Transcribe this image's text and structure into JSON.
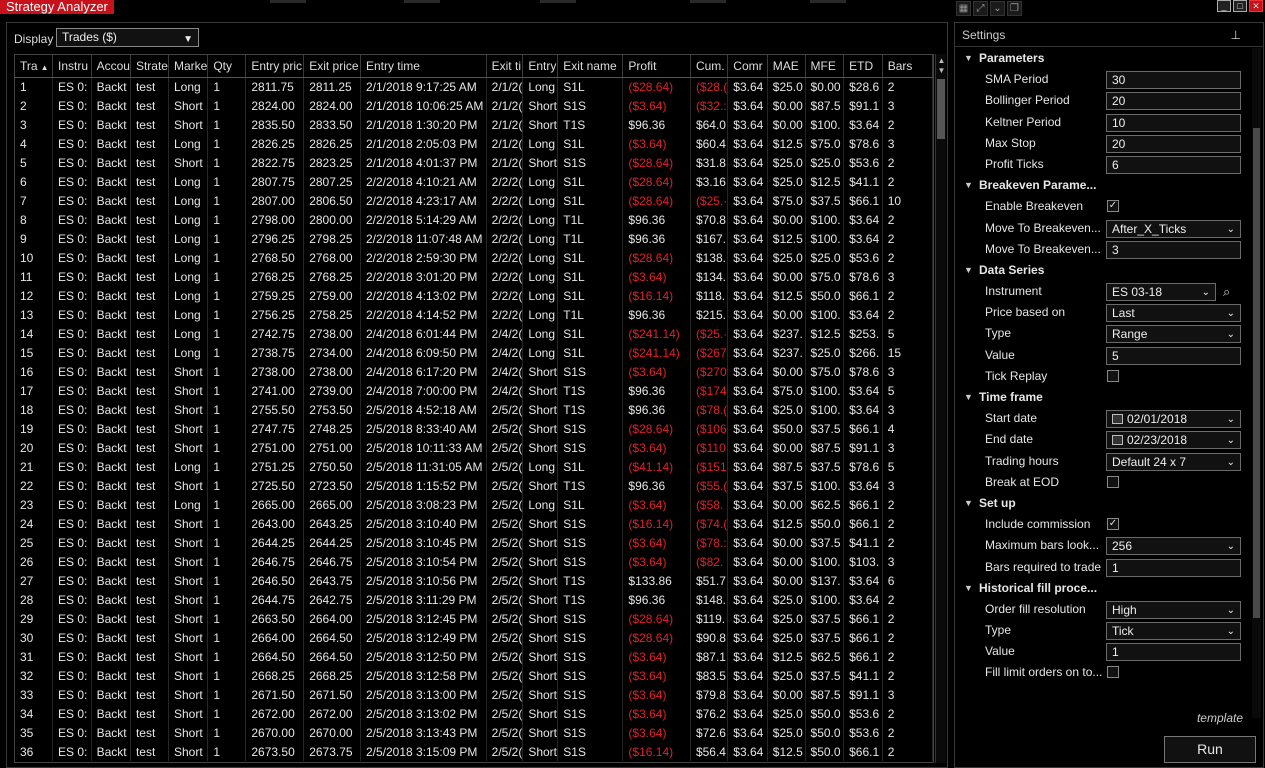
{
  "window": {
    "title": "Strategy Analyzer",
    "window_buttons": [
      "_",
      "□",
      "✕"
    ]
  },
  "display": {
    "label": "Display",
    "value": "Trades ($)"
  },
  "grid": {
    "columns": [
      "Tra",
      "Instru",
      "Accou",
      "Strate",
      "Marke",
      "Qty",
      "Entry pric",
      "Exit price",
      "Entry time",
      "Exit ti",
      "Entry",
      "Exit name",
      "Profit",
      "Cum.",
      "Comr",
      "MAE",
      "MFE",
      "ETD",
      "Bars"
    ],
    "sort_indicator": "▲",
    "rows": [
      [
        "1",
        "ES 0:",
        "Backt",
        "test",
        "Long",
        "1",
        "2811.75",
        "2811.25",
        "2/1/2018 9:17:25 AM",
        "2/1/2(",
        "Long",
        "S1L",
        "($28.64)",
        "($28.(",
        "$3.64",
        "$25.0",
        "$0.00",
        "$28.6",
        "2"
      ],
      [
        "2",
        "ES 0:",
        "Backt",
        "test",
        "Short",
        "1",
        "2824.00",
        "2824.00",
        "2/1/2018 10:06:25 AM",
        "2/1/2(",
        "Short",
        "S1S",
        "($3.64)",
        "($32.:",
        "$3.64",
        "$0.00",
        "$87.5",
        "$91.1",
        "3"
      ],
      [
        "3",
        "ES 0:",
        "Backt",
        "test",
        "Short",
        "1",
        "2835.50",
        "2833.50",
        "2/1/2018 1:30:20 PM",
        "2/1/2(",
        "Short",
        "T1S",
        "$96.36",
        "$64.0",
        "$3.64",
        "$0.00",
        "$100.",
        "$3.64",
        "2"
      ],
      [
        "4",
        "ES 0:",
        "Backt",
        "test",
        "Long",
        "1",
        "2826.25",
        "2826.25",
        "2/1/2018 2:05:03 PM",
        "2/1/2(",
        "Long",
        "S1L",
        "($3.64)",
        "$60.4",
        "$3.64",
        "$12.5",
        "$75.0",
        "$78.6",
        "3"
      ],
      [
        "5",
        "ES 0:",
        "Backt",
        "test",
        "Short",
        "1",
        "2822.75",
        "2823.25",
        "2/1/2018 4:01:37 PM",
        "2/1/2(",
        "Short",
        "S1S",
        "($28.64)",
        "$31.8",
        "$3.64",
        "$25.0",
        "$25.0",
        "$53.6",
        "2"
      ],
      [
        "6",
        "ES 0:",
        "Backt",
        "test",
        "Long",
        "1",
        "2807.75",
        "2807.25",
        "2/2/2018 4:10:21 AM",
        "2/2/2(",
        "Long",
        "S1L",
        "($28.64)",
        "$3.16",
        "$3.64",
        "$25.0",
        "$12.5",
        "$41.1",
        "2"
      ],
      [
        "7",
        "ES 0:",
        "Backt",
        "test",
        "Long",
        "1",
        "2807.00",
        "2806.50",
        "2/2/2018 4:23:17 AM",
        "2/2/2(",
        "Long",
        "S1L",
        "($28.64)",
        "($25.·",
        "$3.64",
        "$75.0",
        "$37.5",
        "$66.1",
        "10"
      ],
      [
        "8",
        "ES 0:",
        "Backt",
        "test",
        "Long",
        "1",
        "2798.00",
        "2800.00",
        "2/2/2018 5:14:29 AM",
        "2/2/2(",
        "Long",
        "T1L",
        "$96.36",
        "$70.8",
        "$3.64",
        "$0.00",
        "$100.",
        "$3.64",
        "2"
      ],
      [
        "9",
        "ES 0:",
        "Backt",
        "test",
        "Long",
        "1",
        "2796.25",
        "2798.25",
        "2/2/2018 11:07:48 AM",
        "2/2/2(",
        "Long",
        "T1L",
        "$96.36",
        "$167.",
        "$3.64",
        "$12.5",
        "$100.",
        "$3.64",
        "2"
      ],
      [
        "10",
        "ES 0:",
        "Backt",
        "test",
        "Long",
        "1",
        "2768.50",
        "2768.00",
        "2/2/2018 2:59:30 PM",
        "2/2/2(",
        "Long",
        "S1L",
        "($28.64)",
        "$138.",
        "$3.64",
        "$25.0",
        "$25.0",
        "$53.6",
        "2"
      ],
      [
        "11",
        "ES 0:",
        "Backt",
        "test",
        "Long",
        "1",
        "2768.25",
        "2768.25",
        "2/2/2018 3:01:20 PM",
        "2/2/2(",
        "Long",
        "S1L",
        "($3.64)",
        "$134.",
        "$3.64",
        "$0.00",
        "$75.0",
        "$78.6",
        "3"
      ],
      [
        "12",
        "ES 0:",
        "Backt",
        "test",
        "Long",
        "1",
        "2759.25",
        "2759.00",
        "2/2/2018 4:13:02 PM",
        "2/2/2(",
        "Long",
        "S1L",
        "($16.14)",
        "$118.",
        "$3.64",
        "$12.5",
        "$50.0",
        "$66.1",
        "2"
      ],
      [
        "13",
        "ES 0:",
        "Backt",
        "test",
        "Long",
        "1",
        "2756.25",
        "2758.25",
        "2/2/2018 4:14:52 PM",
        "2/2/2(",
        "Long",
        "T1L",
        "$96.36",
        "$215.",
        "$3.64",
        "$0.00",
        "$100.",
        "$3.64",
        "2"
      ],
      [
        "14",
        "ES 0:",
        "Backt",
        "test",
        "Long",
        "1",
        "2742.75",
        "2738.00",
        "2/4/2018 6:01:44 PM",
        "2/4/2(",
        "Long",
        "S1L",
        "($241.14)",
        "($25.·",
        "$3.64",
        "$237.",
        "$12.5",
        "$253.",
        "5"
      ],
      [
        "15",
        "ES 0:",
        "Backt",
        "test",
        "Long",
        "1",
        "2738.75",
        "2734.00",
        "2/4/2018 6:09:50 PM",
        "2/4/2(",
        "Long",
        "S1L",
        "($241.14)",
        "($267",
        "$3.64",
        "$237.",
        "$25.0",
        "$266.",
        "15"
      ],
      [
        "16",
        "ES 0:",
        "Backt",
        "test",
        "Short",
        "1",
        "2738.00",
        "2738.00",
        "2/4/2018 6:17:20 PM",
        "2/4/2(",
        "Short",
        "S1S",
        "($3.64)",
        "($270",
        "$3.64",
        "$0.00",
        "$75.0",
        "$78.6",
        "3"
      ],
      [
        "17",
        "ES 0:",
        "Backt",
        "test",
        "Short",
        "1",
        "2741.00",
        "2739.00",
        "2/4/2018 7:00:00 PM",
        "2/4/2(",
        "Short",
        "T1S",
        "$96.36",
        "($174",
        "$3.64",
        "$75.0",
        "$100.",
        "$3.64",
        "5"
      ],
      [
        "18",
        "ES 0:",
        "Backt",
        "test",
        "Short",
        "1",
        "2755.50",
        "2753.50",
        "2/5/2018 4:52:18 AM",
        "2/5/2(",
        "Short",
        "T1S",
        "$96.36",
        "($78.(",
        "$3.64",
        "$25.0",
        "$100.",
        "$3.64",
        "3"
      ],
      [
        "19",
        "ES 0:",
        "Backt",
        "test",
        "Short",
        "1",
        "2747.75",
        "2748.25",
        "2/5/2018 8:33:40 AM",
        "2/5/2(",
        "Short",
        "S1S",
        "($28.64)",
        "($106",
        "$3.64",
        "$50.0",
        "$37.5",
        "$66.1",
        "4"
      ],
      [
        "20",
        "ES 0:",
        "Backt",
        "test",
        "Short",
        "1",
        "2751.00",
        "2751.00",
        "2/5/2018 10:11:33 AM",
        "2/5/2(",
        "Short",
        "S1S",
        "($3.64)",
        "($110",
        "$3.64",
        "$0.00",
        "$87.5",
        "$91.1",
        "3"
      ],
      [
        "21",
        "ES 0:",
        "Backt",
        "test",
        "Long",
        "1",
        "2751.25",
        "2750.50",
        "2/5/2018 11:31:05 AM",
        "2/5/2(",
        "Long",
        "S1L",
        "($41.14)",
        "($151",
        "$3.64",
        "$87.5",
        "$37.5",
        "$78.6",
        "5"
      ],
      [
        "22",
        "ES 0:",
        "Backt",
        "test",
        "Short",
        "1",
        "2725.50",
        "2723.50",
        "2/5/2018 1:15:52 PM",
        "2/5/2(",
        "Short",
        "T1S",
        "$96.36",
        "($55.(",
        "$3.64",
        "$37.5",
        "$100.",
        "$3.64",
        "3"
      ],
      [
        "23",
        "ES 0:",
        "Backt",
        "test",
        "Long",
        "1",
        "2665.00",
        "2665.00",
        "2/5/2018 3:08:23 PM",
        "2/5/2(",
        "Long",
        "S1L",
        "($3.64)",
        "($58.",
        "$3.64",
        "$0.00",
        "$62.5",
        "$66.1",
        "2"
      ],
      [
        "24",
        "ES 0:",
        "Backt",
        "test",
        "Short",
        "1",
        "2643.00",
        "2643.25",
        "2/5/2018 3:10:40 PM",
        "2/5/2(",
        "Short",
        "S1S",
        "($16.14)",
        "($74.(",
        "$3.64",
        "$12.5",
        "$50.0",
        "$66.1",
        "2"
      ],
      [
        "25",
        "ES 0:",
        "Backt",
        "test",
        "Short",
        "1",
        "2644.25",
        "2644.25",
        "2/5/2018 3:10:45 PM",
        "2/5/2(",
        "Short",
        "S1S",
        "($3.64)",
        "($78.:",
        "$3.64",
        "$0.00",
        "$37.5",
        "$41.1",
        "2"
      ],
      [
        "26",
        "ES 0:",
        "Backt",
        "test",
        "Short",
        "1",
        "2646.75",
        "2646.75",
        "2/5/2018 3:10:54 PM",
        "2/5/2(",
        "Short",
        "S1S",
        "($3.64)",
        "($82.",
        "$3.64",
        "$0.00",
        "$100.",
        "$103.",
        "3"
      ],
      [
        "27",
        "ES 0:",
        "Backt",
        "test",
        "Short",
        "1",
        "2646.50",
        "2643.75",
        "2/5/2018 3:10:56 PM",
        "2/5/2(",
        "Short",
        "T1S",
        "$133.86",
        "$51.7",
        "$3.64",
        "$0.00",
        "$137.",
        "$3.64",
        "6"
      ],
      [
        "28",
        "ES 0:",
        "Backt",
        "test",
        "Short",
        "1",
        "2644.75",
        "2642.75",
        "2/5/2018 3:11:29 PM",
        "2/5/2(",
        "Short",
        "T1S",
        "$96.36",
        "$148.",
        "$3.64",
        "$25.0",
        "$100.",
        "$3.64",
        "2"
      ],
      [
        "29",
        "ES 0:",
        "Backt",
        "test",
        "Short",
        "1",
        "2663.50",
        "2664.00",
        "2/5/2018 3:12:45 PM",
        "2/5/2(",
        "Short",
        "S1S",
        "($28.64)",
        "$119.",
        "$3.64",
        "$25.0",
        "$37.5",
        "$66.1",
        "2"
      ],
      [
        "30",
        "ES 0:",
        "Backt",
        "test",
        "Short",
        "1",
        "2664.00",
        "2664.50",
        "2/5/2018 3:12:49 PM",
        "2/5/2(",
        "Short",
        "S1S",
        "($28.64)",
        "$90.8",
        "$3.64",
        "$25.0",
        "$37.5",
        "$66.1",
        "2"
      ],
      [
        "31",
        "ES 0:",
        "Backt",
        "test",
        "Short",
        "1",
        "2664.50",
        "2664.50",
        "2/5/2018 3:12:50 PM",
        "2/5/2(",
        "Short",
        "S1S",
        "($3.64)",
        "$87.1",
        "$3.64",
        "$12.5",
        "$62.5",
        "$66.1",
        "2"
      ],
      [
        "32",
        "ES 0:",
        "Backt",
        "test",
        "Short",
        "1",
        "2668.25",
        "2668.25",
        "2/5/2018 3:12:58 PM",
        "2/5/2(",
        "Short",
        "S1S",
        "($3.64)",
        "$83.5",
        "$3.64",
        "$25.0",
        "$37.5",
        "$41.1",
        "2"
      ],
      [
        "33",
        "ES 0:",
        "Backt",
        "test",
        "Short",
        "1",
        "2671.50",
        "2671.50",
        "2/5/2018 3:13:00 PM",
        "2/5/2(",
        "Short",
        "S1S",
        "($3.64)",
        "$79.8",
        "$3.64",
        "$0.00",
        "$87.5",
        "$91.1",
        "3"
      ],
      [
        "34",
        "ES 0:",
        "Backt",
        "test",
        "Short",
        "1",
        "2672.00",
        "2672.00",
        "2/5/2018 3:13:02 PM",
        "2/5/2(",
        "Short",
        "S1S",
        "($3.64)",
        "$76.2",
        "$3.64",
        "$25.0",
        "$50.0",
        "$53.6",
        "2"
      ],
      [
        "35",
        "ES 0:",
        "Backt",
        "test",
        "Short",
        "1",
        "2670.00",
        "2670.00",
        "2/5/2018 3:13:43 PM",
        "2/5/2(",
        "Short",
        "S1S",
        "($3.64)",
        "$72.6",
        "$3.64",
        "$25.0",
        "$50.0",
        "$53.6",
        "2"
      ],
      [
        "36",
        "ES 0:",
        "Backt",
        "test",
        "Short",
        "1",
        "2673.50",
        "2673.75",
        "2/5/2018 3:15:09 PM",
        "2/5/2(",
        "Short",
        "S1S",
        "($16.14)",
        "$56.4",
        "$3.64",
        "$12.5",
        "$50.0",
        "$66.1",
        "2"
      ]
    ]
  },
  "settings": {
    "title": "Settings",
    "template_label": "template",
    "run_label": "Run",
    "rows": [
      {
        "kind": "cat",
        "label": "Parameters"
      },
      {
        "kind": "text",
        "label": "SMA Period",
        "value": "30"
      },
      {
        "kind": "text",
        "label": "Bollinger Period",
        "value": "20"
      },
      {
        "kind": "text",
        "label": "Keltner Period",
        "value": "10"
      },
      {
        "kind": "text",
        "label": "Max Stop",
        "value": "20"
      },
      {
        "kind": "text",
        "label": "Profit Ticks",
        "value": "6"
      },
      {
        "kind": "cat",
        "label": "Breakeven Parame..."
      },
      {
        "kind": "check",
        "label": "Enable Breakeven",
        "checked": true
      },
      {
        "kind": "select",
        "label": "Move To Breakeven...",
        "value": "After_X_Ticks"
      },
      {
        "kind": "text",
        "label": "Move To Breakeven...",
        "value": "3"
      },
      {
        "kind": "cat",
        "label": "Data Series"
      },
      {
        "kind": "instrument",
        "label": "Instrument",
        "value": "ES 03-18"
      },
      {
        "kind": "select",
        "label": "Price based on",
        "value": "Last"
      },
      {
        "kind": "select",
        "label": "Type",
        "value": "Range"
      },
      {
        "kind": "text",
        "label": "Value",
        "value": "5"
      },
      {
        "kind": "check",
        "label": "Tick Replay",
        "checked": false
      },
      {
        "kind": "cat",
        "label": "Time frame"
      },
      {
        "kind": "date",
        "label": "Start date",
        "value": "02/01/2018"
      },
      {
        "kind": "date",
        "label": "End date",
        "value": "02/23/2018"
      },
      {
        "kind": "select",
        "label": "Trading hours",
        "value": "Default 24 x 7"
      },
      {
        "kind": "check",
        "label": "Break at EOD",
        "checked": false
      },
      {
        "kind": "cat",
        "label": "Set up"
      },
      {
        "kind": "check",
        "label": "Include commission",
        "checked": true
      },
      {
        "kind": "select",
        "label": "Maximum bars look...",
        "value": "256"
      },
      {
        "kind": "text",
        "label": "Bars required to trade",
        "value": "1"
      },
      {
        "kind": "cat",
        "label": "Historical fill proce..."
      },
      {
        "kind": "select",
        "label": "Order fill resolution",
        "value": "High"
      },
      {
        "kind": "select",
        "label": "Type",
        "value": "Tick"
      },
      {
        "kind": "text",
        "label": "Value",
        "value": "1"
      },
      {
        "kind": "check",
        "label": "Fill limit orders on to...",
        "checked": false
      }
    ]
  },
  "colors": {
    "accent": "#c8121b",
    "negative": "#e0202a",
    "background": "#000000"
  }
}
